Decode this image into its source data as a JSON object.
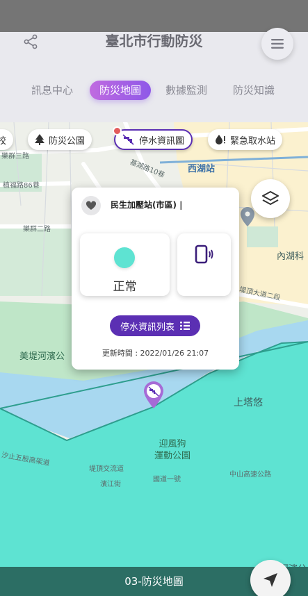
{
  "header": {
    "title": "臺北市行動防災",
    "share_icon": "share-icon",
    "menu_icon": "hamburger-menu-icon"
  },
  "tabs": [
    {
      "label": "訊息中心",
      "active": false
    },
    {
      "label": "防災地圖",
      "active": true
    },
    {
      "label": "數據監測",
      "active": false
    },
    {
      "label": "防災知識",
      "active": false
    }
  ],
  "filter_chips": [
    {
      "label": "校",
      "icon": ""
    },
    {
      "label": "防災公園",
      "icon": "tree-icon"
    },
    {
      "label": "停水資訊圖",
      "icon": "water-outage-icon",
      "active": true
    },
    {
      "label": "緊急取水站",
      "icon": "water-drop-icon"
    }
  ],
  "map_labels": {
    "l1": "樂群三路",
    "l2": "基湖路10巷",
    "l3": "西湖站",
    "l4": "植福路86巷",
    "l5": "樂群二路",
    "l6": "內湖科",
    "l7": "堤頂大道二段",
    "l8": "美堤河濱公",
    "l9": "上塔悠",
    "l10": "迎風狗\n運動公園",
    "l11": "汐止五股高架道",
    "l12": "堤頂交流道",
    "l13": "濱江街",
    "l14": "國道一號",
    "l15": "中山高速公路",
    "l16": "河濱公"
  },
  "popup": {
    "station_name": "民生加壓站(市區) |",
    "status_label": "正常",
    "status_color": "#5ee3d2",
    "list_button_label": "停水資訊列表",
    "update_time": "更新時間 : 2022/01/26 21:07"
  },
  "colors": {
    "accent": "#5b2fb3",
    "tab_gradient_start": "#c06be0",
    "tab_gradient_end": "#8e58e8",
    "water": "#5ee3d2",
    "river": "#a8d8f0",
    "bottom_bar": "#2c6e64"
  },
  "bottom": {
    "label": "03-防災地圖"
  }
}
